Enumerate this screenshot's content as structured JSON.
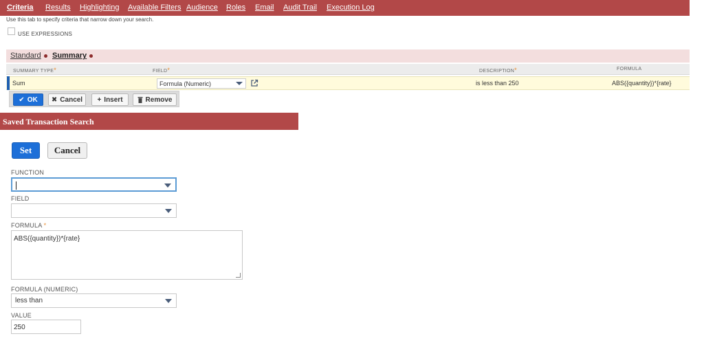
{
  "tabs": [
    {
      "label": "Criteria",
      "active": true
    },
    {
      "label": "Results"
    },
    {
      "label": "Highlighting"
    },
    {
      "label": "Available Filters"
    },
    {
      "label": "Audience"
    },
    {
      "label": "Roles"
    },
    {
      "label": "Email"
    },
    {
      "label": "Audit Trail"
    },
    {
      "label": "Execution Log"
    }
  ],
  "criteria": {
    "help_text": "Use this tab to specify criteria that narrow down your search.",
    "use_expressions_label": "USE EXPRESSIONS",
    "use_expressions_checked": false,
    "subtabs": [
      {
        "label": "Standard"
      },
      {
        "label": "Summary",
        "active": true
      }
    ],
    "columns": {
      "summary_type": "SUMMARY TYPE",
      "field": "FIELD",
      "description": "DESCRIPTION",
      "formula": "FORMULA"
    },
    "row": {
      "summary_type": "Sum",
      "field": "Formula (Numeric)",
      "description": "is less than 250",
      "formula": "ABS({quantity})*{rate}"
    },
    "row_buttons": {
      "ok": "OK",
      "cancel": "Cancel",
      "insert": "Insert",
      "remove": "Remove"
    }
  },
  "popup": {
    "title": "Saved Transaction Search",
    "set_label": "Set",
    "cancel_label": "Cancel",
    "function_label": "FUNCTION",
    "function_value": "",
    "field_label": "FIELD",
    "field_value": "",
    "formula_label": "FORMULA",
    "formula_value": "ABS({quantity})*{rate}",
    "formula_numeric_label": "FORMULA (NUMERIC)",
    "formula_numeric_value": "less than",
    "value_label": "VALUE",
    "value_value": "250"
  },
  "colors": {
    "header_red": "#b24848",
    "primary_blue": "#1d6fd8",
    "required_orange": "#e7892b",
    "row_highlight": "#fffbdc"
  }
}
